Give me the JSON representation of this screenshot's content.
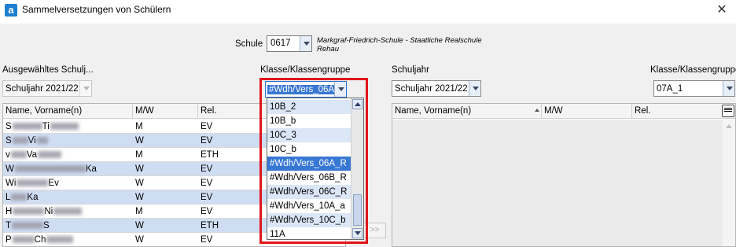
{
  "window": {
    "title": "Sammelversetzungen von Schülern",
    "logo_letter": "a",
    "close_glyph": "✕"
  },
  "school": {
    "label": "Schule",
    "code": "0617",
    "name": "Markgraf-Friedrich-Schule - Staatliche Realschule Rehau"
  },
  "left": {
    "year_label": "Ausgewähltes Schulj...",
    "year_value": "Schuljahr 2021/22",
    "class_label": "Klasse/Klassengruppe",
    "class_value": "#Wdh/Vers_06A",
    "columns": [
      "Name, Vorname(n)",
      "M/W",
      "Rel."
    ],
    "rows": [
      {
        "name_initial": "S",
        "name_mid": "Ti",
        "gender": "M",
        "rel": "EV"
      },
      {
        "name_initial": "S",
        "name_mid": "Vi",
        "gender": "W",
        "rel": "EV"
      },
      {
        "name_initial": "v",
        "name_mid": "Va",
        "gender": "M",
        "rel": "ETH"
      },
      {
        "name_initial": "W",
        "name_mid": "Ka",
        "gender": "W",
        "rel": "EV"
      },
      {
        "name_initial": "Wi",
        "name_mid": "Ev",
        "gender": "W",
        "rel": "EV"
      },
      {
        "name_initial": "L",
        "name_mid": "Ka",
        "gender": "W",
        "rel": "EV"
      },
      {
        "name_initial": "H",
        "name_mid": "Ni",
        "gender": "M",
        "rel": "EV"
      },
      {
        "name_initial": "T",
        "name_mid": "S",
        "gender": "W",
        "rel": "ETH"
      },
      {
        "name_initial": "P",
        "name_mid": "Ch",
        "gender": "W",
        "rel": "EV"
      }
    ]
  },
  "dropdown": {
    "options": [
      "10B_2",
      "10B_b",
      "10C_3",
      "10C_b",
      "#Wdh/Vers_06A_R",
      "#Wdh/Vers_06B_R",
      "#Wdh/Vers_06C_R",
      "#Wdh/Vers_10A_a",
      "#Wdh/Vers_10C_b",
      "11A"
    ],
    "selected": "#Wdh/Vers_06A_R"
  },
  "right": {
    "year_label": "Schuljahr",
    "year_value": "Schuljahr 2021/22",
    "class_label": "Klasse/Klassengruppe",
    "class_value": "07A_1",
    "columns": [
      "Name, Vorname(n)",
      "M/W",
      "Rel."
    ]
  },
  "move_button_label": ">>",
  "colors": {
    "highlight": "#e0161b",
    "selection": "#3877d4",
    "row_alt": "#cfddf3"
  }
}
